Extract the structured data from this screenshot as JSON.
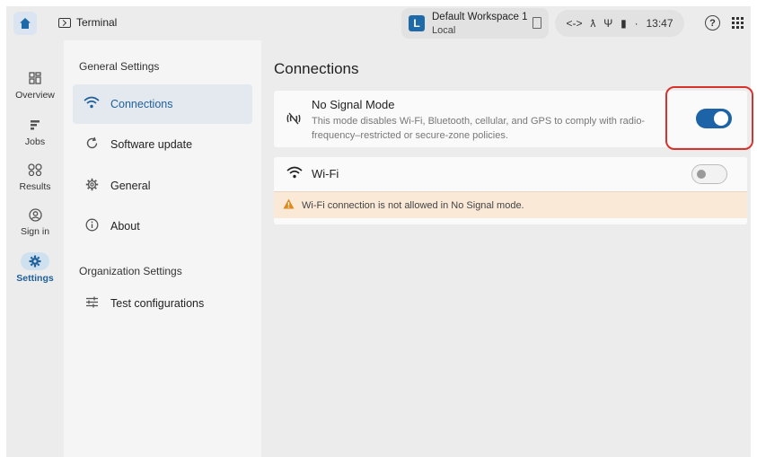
{
  "topbar": {
    "home_icon": "home-icon",
    "app_title": "Terminal",
    "workspace": {
      "badge": "L",
      "name": "Default Workspace 1",
      "location": "Local"
    },
    "status": {
      "link_glyph": "<->",
      "signal_glyph": "ƛ",
      "usb_glyph": "Ψ",
      "battery_glyph": "▮",
      "separator": "·",
      "time": "13:47"
    },
    "help_glyph": "?"
  },
  "rail": {
    "items": [
      {
        "label": "Overview",
        "icon": "dashboard-icon"
      },
      {
        "label": "Jobs",
        "icon": "jobs-icon"
      },
      {
        "label": "Results",
        "icon": "results-icon"
      },
      {
        "label": "Sign in",
        "icon": "account-icon"
      },
      {
        "label": "Settings",
        "icon": "gear-icon",
        "active": true
      }
    ]
  },
  "nav": {
    "general_heading": "General Settings",
    "items": [
      {
        "label": "Connections",
        "icon": "wifi-icon",
        "active": true
      },
      {
        "label": "Software update",
        "icon": "refresh-icon"
      },
      {
        "label": "General",
        "icon": "gear-icon"
      },
      {
        "label": "About",
        "icon": "info-icon"
      }
    ],
    "org_heading": "Organization Settings",
    "org_items": [
      {
        "label": "Test configurations",
        "icon": "sliders-icon"
      }
    ]
  },
  "main": {
    "title": "Connections",
    "no_signal": {
      "title": "No Signal Mode",
      "description": "This mode disables Wi-Fi, Bluetooth, cellular, and GPS to comply with radio-frequency–restricted or secure-zone policies.",
      "enabled": true
    },
    "wifi": {
      "label": "Wi-Fi",
      "enabled": false,
      "warning": "Wi-Fi connection is not allowed in No Signal mode."
    }
  },
  "colors": {
    "accent": "#1d63a8",
    "highlight": "#d9312b",
    "warning_bg": "#fbe9d8",
    "warning_icon": "#e08a1e"
  }
}
